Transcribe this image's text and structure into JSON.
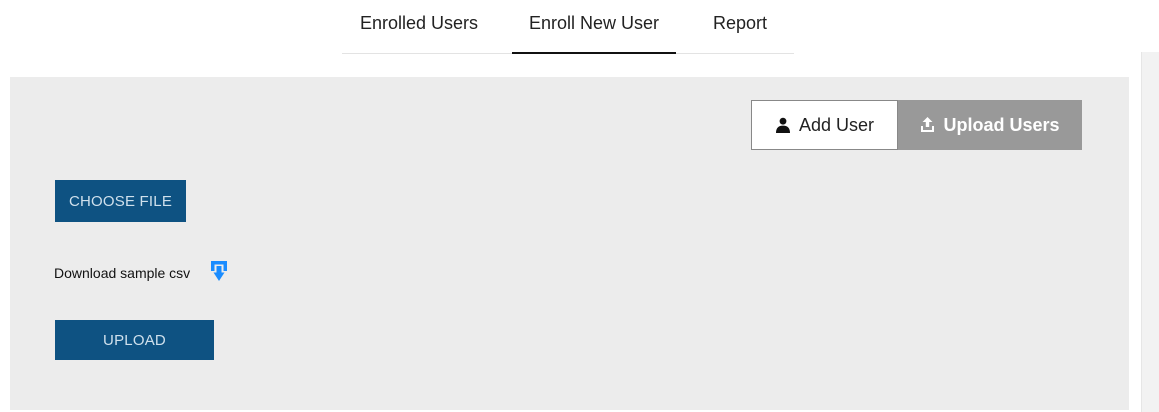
{
  "tabs": {
    "enrolled_users": "Enrolled Users",
    "enroll_new_user": "Enroll New User",
    "report": "Report",
    "active": "Enroll New User"
  },
  "toggle": {
    "add_user": "Add User",
    "upload_users": "Upload Users",
    "selected": "Upload Users"
  },
  "upload_form": {
    "choose_file": "CHOOSE FILE",
    "download_sample": "Download sample csv",
    "upload": "UPLOAD"
  },
  "icons": {
    "add_user": "user-icon",
    "upload_users": "upload-icon",
    "download_sample": "download-icon"
  },
  "colors": {
    "primary_button": "#0e5282",
    "toggle_selected": "#999999",
    "panel_background": "#ececec",
    "download_icon": "#1a8cff"
  }
}
